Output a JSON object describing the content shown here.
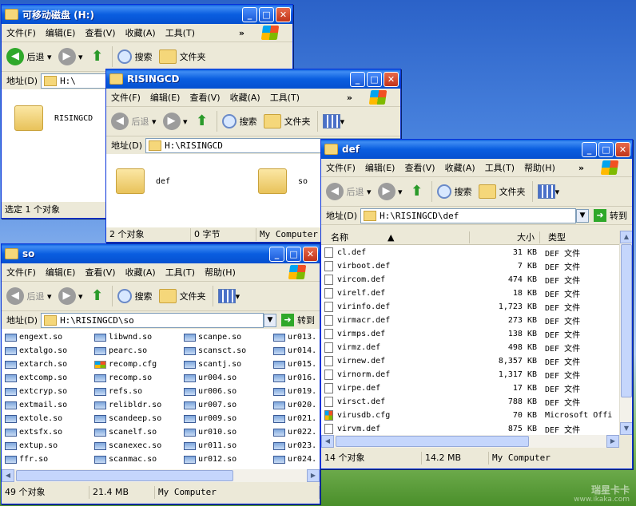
{
  "watermark": {
    "brand": "瑞星卡卡",
    "url": "www.ikaka.com"
  },
  "menu": {
    "file": "文件(F)",
    "edit": "编辑(E)",
    "view": "查看(V)",
    "fav": "收藏(A)",
    "tools": "工具(T)",
    "help": "帮助(H)",
    "more": "»"
  },
  "toolbar": {
    "back": "后退",
    "search": "搜索",
    "folders": "文件夹"
  },
  "address_label": "地址(D)",
  "go_label": "转到",
  "win_h": {
    "title": "可移动磁盘 (H:)",
    "address": "H:\\",
    "folder": "RISINGCD",
    "status": "选定 1 个对象"
  },
  "win_r": {
    "title": "RISINGCD",
    "address": "H:\\RISINGCD",
    "folders": [
      "def",
      "so"
    ],
    "status": [
      "2 个对象",
      "0 字节",
      "My Computer"
    ]
  },
  "win_def": {
    "title": "def",
    "address": "H:\\RISINGCD\\def",
    "columns": [
      "名称",
      "大小",
      "类型"
    ],
    "files": [
      {
        "name": "cl.def",
        "size": "31 KB",
        "type": "DEF 文件"
      },
      {
        "name": "virboot.def",
        "size": "7 KB",
        "type": "DEF 文件"
      },
      {
        "name": "vircom.def",
        "size": "474 KB",
        "type": "DEF 文件"
      },
      {
        "name": "virelf.def",
        "size": "18 KB",
        "type": "DEF 文件"
      },
      {
        "name": "virinfo.def",
        "size": "1,723 KB",
        "type": "DEF 文件"
      },
      {
        "name": "virmacr.def",
        "size": "273 KB",
        "type": "DEF 文件"
      },
      {
        "name": "virmps.def",
        "size": "138 KB",
        "type": "DEF 文件"
      },
      {
        "name": "virmz.def",
        "size": "498 KB",
        "type": "DEF 文件"
      },
      {
        "name": "virnew.def",
        "size": "8,357 KB",
        "type": "DEF 文件"
      },
      {
        "name": "virnorm.def",
        "size": "1,317 KB",
        "type": "DEF 文件"
      },
      {
        "name": "virpe.def",
        "size": "17 KB",
        "type": "DEF 文件"
      },
      {
        "name": "virsct.def",
        "size": "788 KB",
        "type": "DEF 文件"
      },
      {
        "name": "virusdb.cfg",
        "size": "70 KB",
        "type": "Microsoft Offi",
        "cfg": true
      },
      {
        "name": "virvm.def",
        "size": "875 KB",
        "type": "DEF 文件"
      }
    ],
    "status": [
      "14 个对象",
      "14.2 MB",
      "My Computer"
    ]
  },
  "win_so": {
    "title": "so",
    "address": "H:\\RISINGCD\\so",
    "columns": [
      [
        "engext.so",
        "extalgo.so",
        "extarch.so",
        "extcomp.so",
        "extcryp.so",
        "extmail.so",
        "extole.so",
        "extsfx.so",
        "extup.so",
        "ffr.so"
      ],
      [
        "libwnd.so",
        "pearc.so",
        "recomp.cfg",
        "recomp.so",
        "refs.so",
        "relibldr.so",
        "scandeep.so",
        "scanelf.so",
        "scanexec.so",
        "scanmac.so"
      ],
      [
        "scanpe.so",
        "scansct.so",
        "scantj.so",
        "ur004.so",
        "ur006.so",
        "ur007.so",
        "ur009.so",
        "ur010.so",
        "ur011.so",
        "ur012.so"
      ],
      [
        "ur013.",
        "ur014.",
        "ur015.",
        "ur016.",
        "ur019.",
        "ur020.",
        "ur021.",
        "ur022.",
        "ur023.",
        "ur024."
      ]
    ],
    "status": [
      "49 个对象",
      "21.4 MB",
      "My Computer"
    ]
  }
}
